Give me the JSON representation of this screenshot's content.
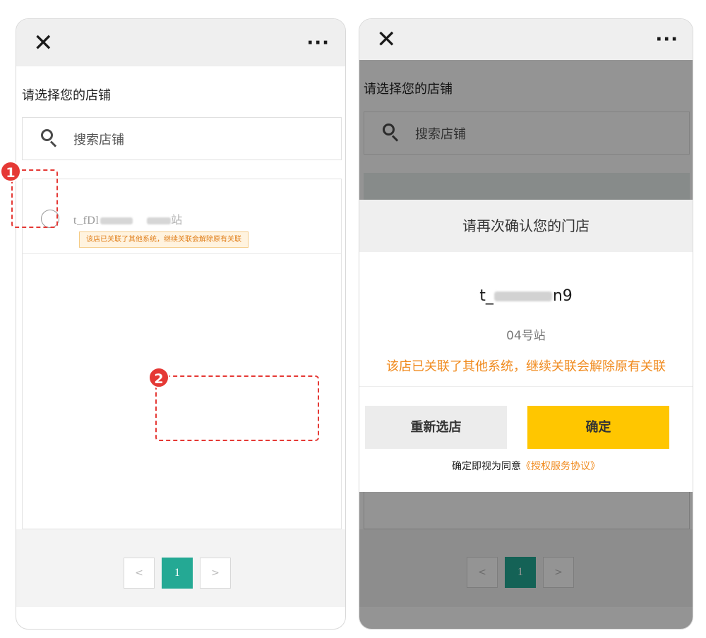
{
  "left_screen": {
    "titlebar": {
      "close_icon": "close-icon",
      "more_icon": "more-icon",
      "close_glyph": "✕",
      "more_glyph": "···"
    },
    "heading": "请选择您的店铺",
    "search": {
      "placeholder": "搜索店铺",
      "icon": "search-icon"
    },
    "store_item": {
      "name_prefix": "t_fDl",
      "name_suffix": "站",
      "warning": "该店已关联了其他系统，继续关联会解除原有关联"
    },
    "pagination": {
      "prev": "<",
      "current": "1",
      "next": ">"
    },
    "annotation": {
      "number": "1"
    }
  },
  "right_screen": {
    "titlebar": {
      "close_icon": "close-icon",
      "more_icon": "more-icon",
      "close_glyph": "✕",
      "more_glyph": "···"
    },
    "heading": "请选择您的店铺",
    "search": {
      "placeholder": "搜索店铺",
      "icon": "search-icon"
    },
    "modal": {
      "title": "请再次确认您的门店",
      "store_prefix": "t_",
      "store_suffix": "n9",
      "store_sub": "04号站",
      "warning": "该店已关联了其他系统，继续关联会解除原有关联",
      "reselect_label": "重新选店",
      "confirm_label": "确定",
      "agreement_text": "确定即视为同意",
      "agreement_link": "《授权服务协议》"
    },
    "pagination": {
      "prev": "<",
      "current": "1",
      "next": ">"
    },
    "annotation": {
      "number": "2"
    }
  },
  "colors": {
    "accent_yellow": "#ffc600",
    "warning_orange": "#f08a1d",
    "page_green": "#24a994",
    "annotation_red": "#e53935"
  }
}
